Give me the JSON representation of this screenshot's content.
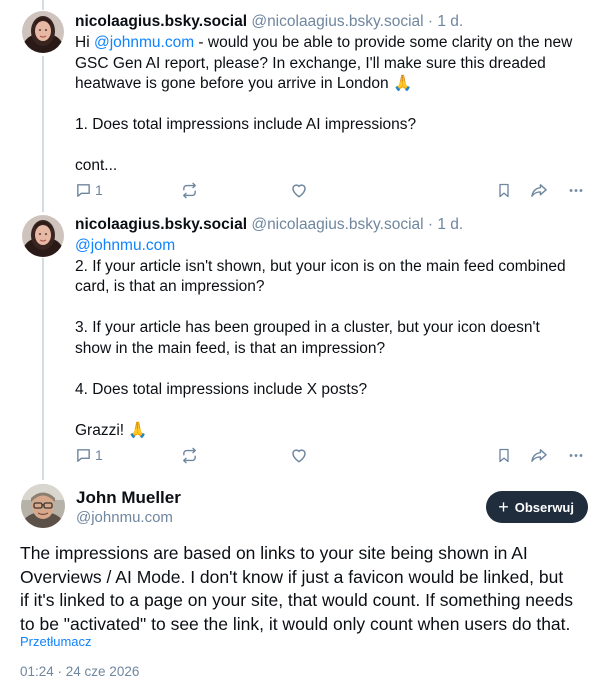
{
  "reply1": {
    "author_name": "nicolaagius.bsky.social",
    "author_handle": "@nicolaagius.bsky.social",
    "separator": " · ",
    "time": "1 d.",
    "greeting": "Hi ",
    "mention": "@johnmu.com",
    "line1_rest": " - would you be able to provide some clarity on the new",
    "line2": "GSC Gen AI report, please? In exchange, I'll make sure this dreaded",
    "line3": "heatwave is gone before you arrive in London 🙏",
    "question1": "1. Does total impressions include AI impressions?",
    "cont": "cont...",
    "reply_count": "1"
  },
  "reply2": {
    "author_name": "nicolaagius.bsky.social",
    "author_handle": "@nicolaagius.bsky.social",
    "separator": " · ",
    "time": "1 d.",
    "mention": "@johnmu.com",
    "q2_line1": "2. If your article isn't shown, but your icon is on the main feed combined",
    "q2_line2": "card, is that an impression?",
    "q3_line1": "3. If your article has been grouped in a cluster, but your icon doesn't",
    "q3_line2": "show in the main feed, is that an impression?",
    "q4": "4. Does total impressions include X posts?",
    "thanks": "Grazzi! 🙏",
    "reply_count": "1"
  },
  "main_post": {
    "author_name": "John Mueller",
    "author_handle": "@johnmu.com",
    "follow_label": "Obserwuj",
    "line1": "The impressions are based on links to your site being shown in AI",
    "line2": "Overviews / AI Mode. I don't know if just a favicon would be linked, but",
    "line3": "if it's linked to a page on your site, that would count. If something needs",
    "line4": "to be \"activated\" to see the link, it would only count when users do that.",
    "translate_label": "Przetłumacz",
    "timestamp": "01:24 · 24 cze 2026"
  },
  "icons": [
    "reply-icon",
    "repost-icon",
    "like-icon",
    "bookmark-icon",
    "share-icon",
    "more-icon",
    "plus-icon"
  ],
  "colors": {
    "link": "#1083fe",
    "muted": "#6f869f",
    "thread_line": "#d4dbe2",
    "follow_bg": "#1f2d3d"
  }
}
